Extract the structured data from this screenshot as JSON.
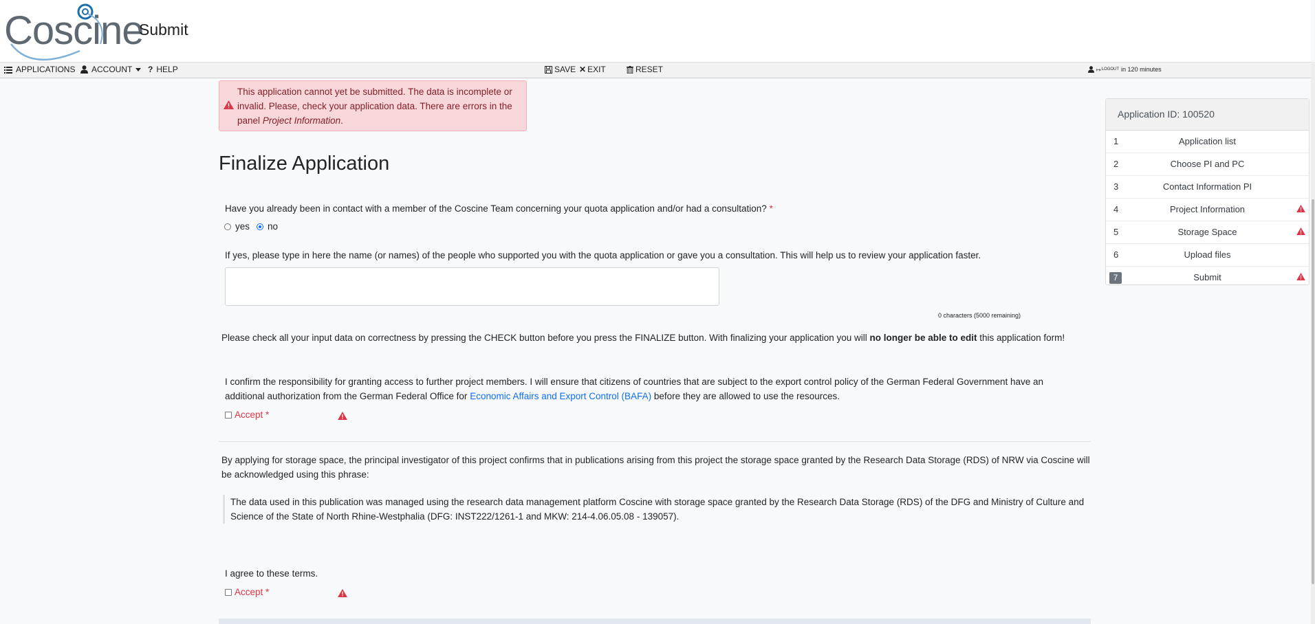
{
  "header": {
    "logo_text": "Coscine",
    "page_title": "Submit"
  },
  "menubar": {
    "applications": "APPLICATIONS",
    "account": "ACCOUNT",
    "help": "HELP",
    "save": "SAVE",
    "exit": "EXIT",
    "reset": "RESET",
    "logout": "LOGOUT",
    "session": "in 120 minutes"
  },
  "alert": {
    "text": "This application cannot yet be submitted. The data is incomplete or invalid. Please, check your application data. There are errors in the panel",
    "panel_name": "Project Information",
    "end": "."
  },
  "main": {
    "title": "Finalize Application",
    "contact_question": "Have you already been in contact with a member of the Coscine Team concerning your quota application and/or had a consultation?",
    "required_mark": "*",
    "radio_yes": "yes",
    "radio_no": "no",
    "radio_selected": "no",
    "names_prompt": "If yes, please type in here the name (or names) of the people who supported you with the quota application or gave you a consultation. This will help us to review your application faster.",
    "names_value": "",
    "char_counter": "0 characters (5000 remaining)",
    "check_text_1": "Please check all your input data on correctness by pressing the CHECK button before you press the FINALIZE button. With finalizing your application you will",
    "check_text_bold": "no longer be able to edit",
    "check_text_2": "this application form!",
    "confirm_text_1": "I confirm the responsibility for granting access to further project members. I will ensure that citizens of countries that are subject to the export control policy of the German Federal Government have an additional authorization from the German Federal Office for",
    "confirm_link": "Economic Affairs and Export Control (BAFA)",
    "confirm_text_2": "before they are allowed to use the resources.",
    "accept_label": "Accept",
    "rds_text": "By applying for storage space, the principal investigator of this project confirms that in publications arising from this project the storage space granted by the Research Data Storage (RDS) of NRW via Coscine will be acknowledged using this phrase:",
    "rds_quote": "The data used in this publication was managed using the research data management platform Coscine with storage space granted by the Research Data Storage (RDS) of the DFG and Ministry of Culture and Science of the State of North Rhine-Westphalia (DFG: INST222/1261-1 and MKW: 214-4.06.05.08 - 139057).",
    "agree_text": "I agree to these terms."
  },
  "panel": {
    "title": "Application ID: 100520",
    "steps": [
      {
        "num": "1",
        "label": "Application list",
        "warn": false
      },
      {
        "num": "2",
        "label": "Choose PI and PC",
        "warn": false
      },
      {
        "num": "3",
        "label": "Contact Information PI",
        "warn": false
      },
      {
        "num": "4",
        "label": "Project Information",
        "warn": true
      },
      {
        "num": "5",
        "label": "Storage Space",
        "warn": true
      },
      {
        "num": "6",
        "label": "Upload files",
        "warn": false
      },
      {
        "num": "7",
        "label": "Submit",
        "warn": true
      }
    ]
  },
  "colors": {
    "error": "#dc3545",
    "link": "#0d6efd",
    "alert_bg": "#f8d7da"
  }
}
